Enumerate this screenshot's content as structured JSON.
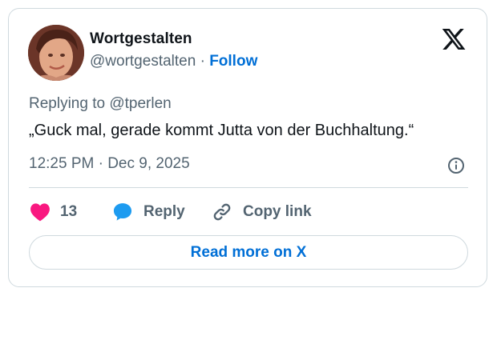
{
  "author": {
    "display_name": "Wortgestalten",
    "handle": "@wortgestalten",
    "separator": "·",
    "follow_label": "Follow"
  },
  "tweet": {
    "replying_prefix": "Replying to",
    "replying_to": "@tperlen",
    "text": "„Guck mal, gerade kommt Jutta von der Buchhaltung.“",
    "timestamp": "12:25 PM · Dec 9, 2025"
  },
  "actions": {
    "like_count": "13",
    "reply_label": "Reply",
    "copy_label": "Copy link"
  },
  "read_more_label": "Read more on X",
  "icons": {
    "logo": "x-logo-icon",
    "info": "info-icon",
    "like": "heart-icon",
    "reply": "speech-bubble-icon",
    "copy": "link-icon"
  },
  "colors": {
    "like": "#f91880",
    "reply": "#1d9bf0",
    "link": "#006fd6",
    "secondary_text": "#536471",
    "primary_text": "#0f1419",
    "border": "#cfd9de"
  }
}
